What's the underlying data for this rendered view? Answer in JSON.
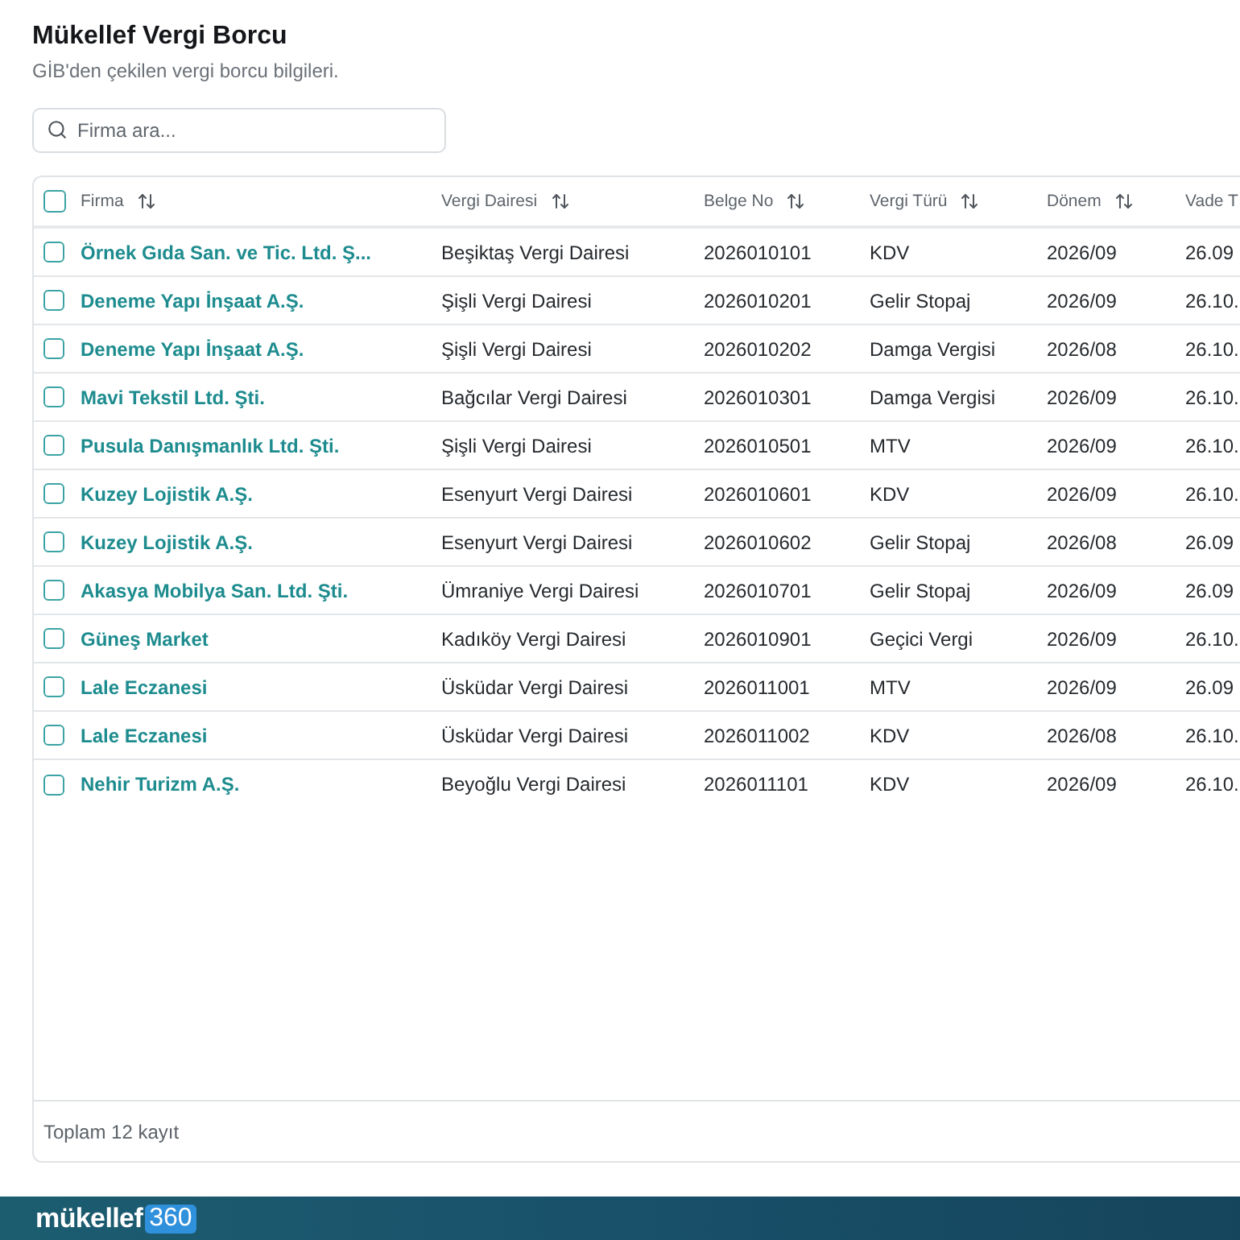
{
  "page": {
    "title": "Mükellef Vergi Borcu",
    "subtitle": "GİB'den çekilen vergi borcu bilgileri."
  },
  "search": {
    "placeholder": "Firma ara..."
  },
  "table": {
    "select_all": {
      "checked": false
    },
    "columns": [
      {
        "label": "Firma",
        "kind": "link",
        "sortable": true
      },
      {
        "label": "Vergi Dairesi",
        "kind": "text",
        "sortable": true
      },
      {
        "label": "Belge No",
        "kind": "text",
        "sortable": true
      },
      {
        "label": "Vergi Türü",
        "kind": "text",
        "sortable": true
      },
      {
        "label": "Dönem",
        "kind": "text",
        "sortable": true
      },
      {
        "label": "Vade T",
        "kind": "text",
        "sortable": false
      }
    ],
    "rows": [
      {
        "checked": false,
        "cells": [
          "Örnek Gıda San. ve Tic. Ltd. Ş...",
          "Beşiktaş Vergi Dairesi",
          "2026010101",
          "KDV",
          "2026/09",
          "26.09"
        ]
      },
      {
        "checked": false,
        "cells": [
          "Deneme Yapı İnşaat A.Ş.",
          "Şişli Vergi Dairesi",
          "2026010201",
          "Gelir Stopaj",
          "2026/09",
          "26.10."
        ]
      },
      {
        "checked": false,
        "cells": [
          "Deneme Yapı İnşaat A.Ş.",
          "Şişli Vergi Dairesi",
          "2026010202",
          "Damga Vergisi",
          "2026/08",
          "26.10."
        ]
      },
      {
        "checked": false,
        "cells": [
          "Mavi Tekstil Ltd. Şti.",
          "Bağcılar Vergi Dairesi",
          "2026010301",
          "Damga Vergisi",
          "2026/09",
          "26.10."
        ]
      },
      {
        "checked": false,
        "cells": [
          "Pusula Danışmanlık Ltd. Şti.",
          "Şişli Vergi Dairesi",
          "2026010501",
          "MTV",
          "2026/09",
          "26.10."
        ]
      },
      {
        "checked": false,
        "cells": [
          "Kuzey Lojistik A.Ş.",
          "Esenyurt Vergi Dairesi",
          "2026010601",
          "KDV",
          "2026/09",
          "26.10."
        ]
      },
      {
        "checked": false,
        "cells": [
          "Kuzey Lojistik A.Ş.",
          "Esenyurt Vergi Dairesi",
          "2026010602",
          "Gelir Stopaj",
          "2026/08",
          "26.09"
        ]
      },
      {
        "checked": false,
        "cells": [
          "Akasya Mobilya San. Ltd. Şti.",
          "Ümraniye Vergi Dairesi",
          "2026010701",
          "Gelir Stopaj",
          "2026/09",
          "26.09"
        ]
      },
      {
        "checked": false,
        "cells": [
          "Güneş Market",
          "Kadıköy Vergi Dairesi",
          "2026010901",
          "Geçici Vergi",
          "2026/09",
          "26.10."
        ]
      },
      {
        "checked": false,
        "cells": [
          "Lale Eczanesi",
          "Üsküdar Vergi Dairesi",
          "2026011001",
          "MTV",
          "2026/09",
          "26.09"
        ]
      },
      {
        "checked": false,
        "cells": [
          "Lale Eczanesi",
          "Üsküdar Vergi Dairesi",
          "2026011002",
          "KDV",
          "2026/08",
          "26.10."
        ]
      },
      {
        "checked": false,
        "cells": [
          "Nehir Turizm A.Ş.",
          "Beyoğlu Vergi Dairesi",
          "2026011101",
          "KDV",
          "2026/09",
          "26.10."
        ]
      }
    ],
    "footer": "Toplam 12 kayıt"
  },
  "brand": {
    "name": "mükellef",
    "badge": "360"
  }
}
